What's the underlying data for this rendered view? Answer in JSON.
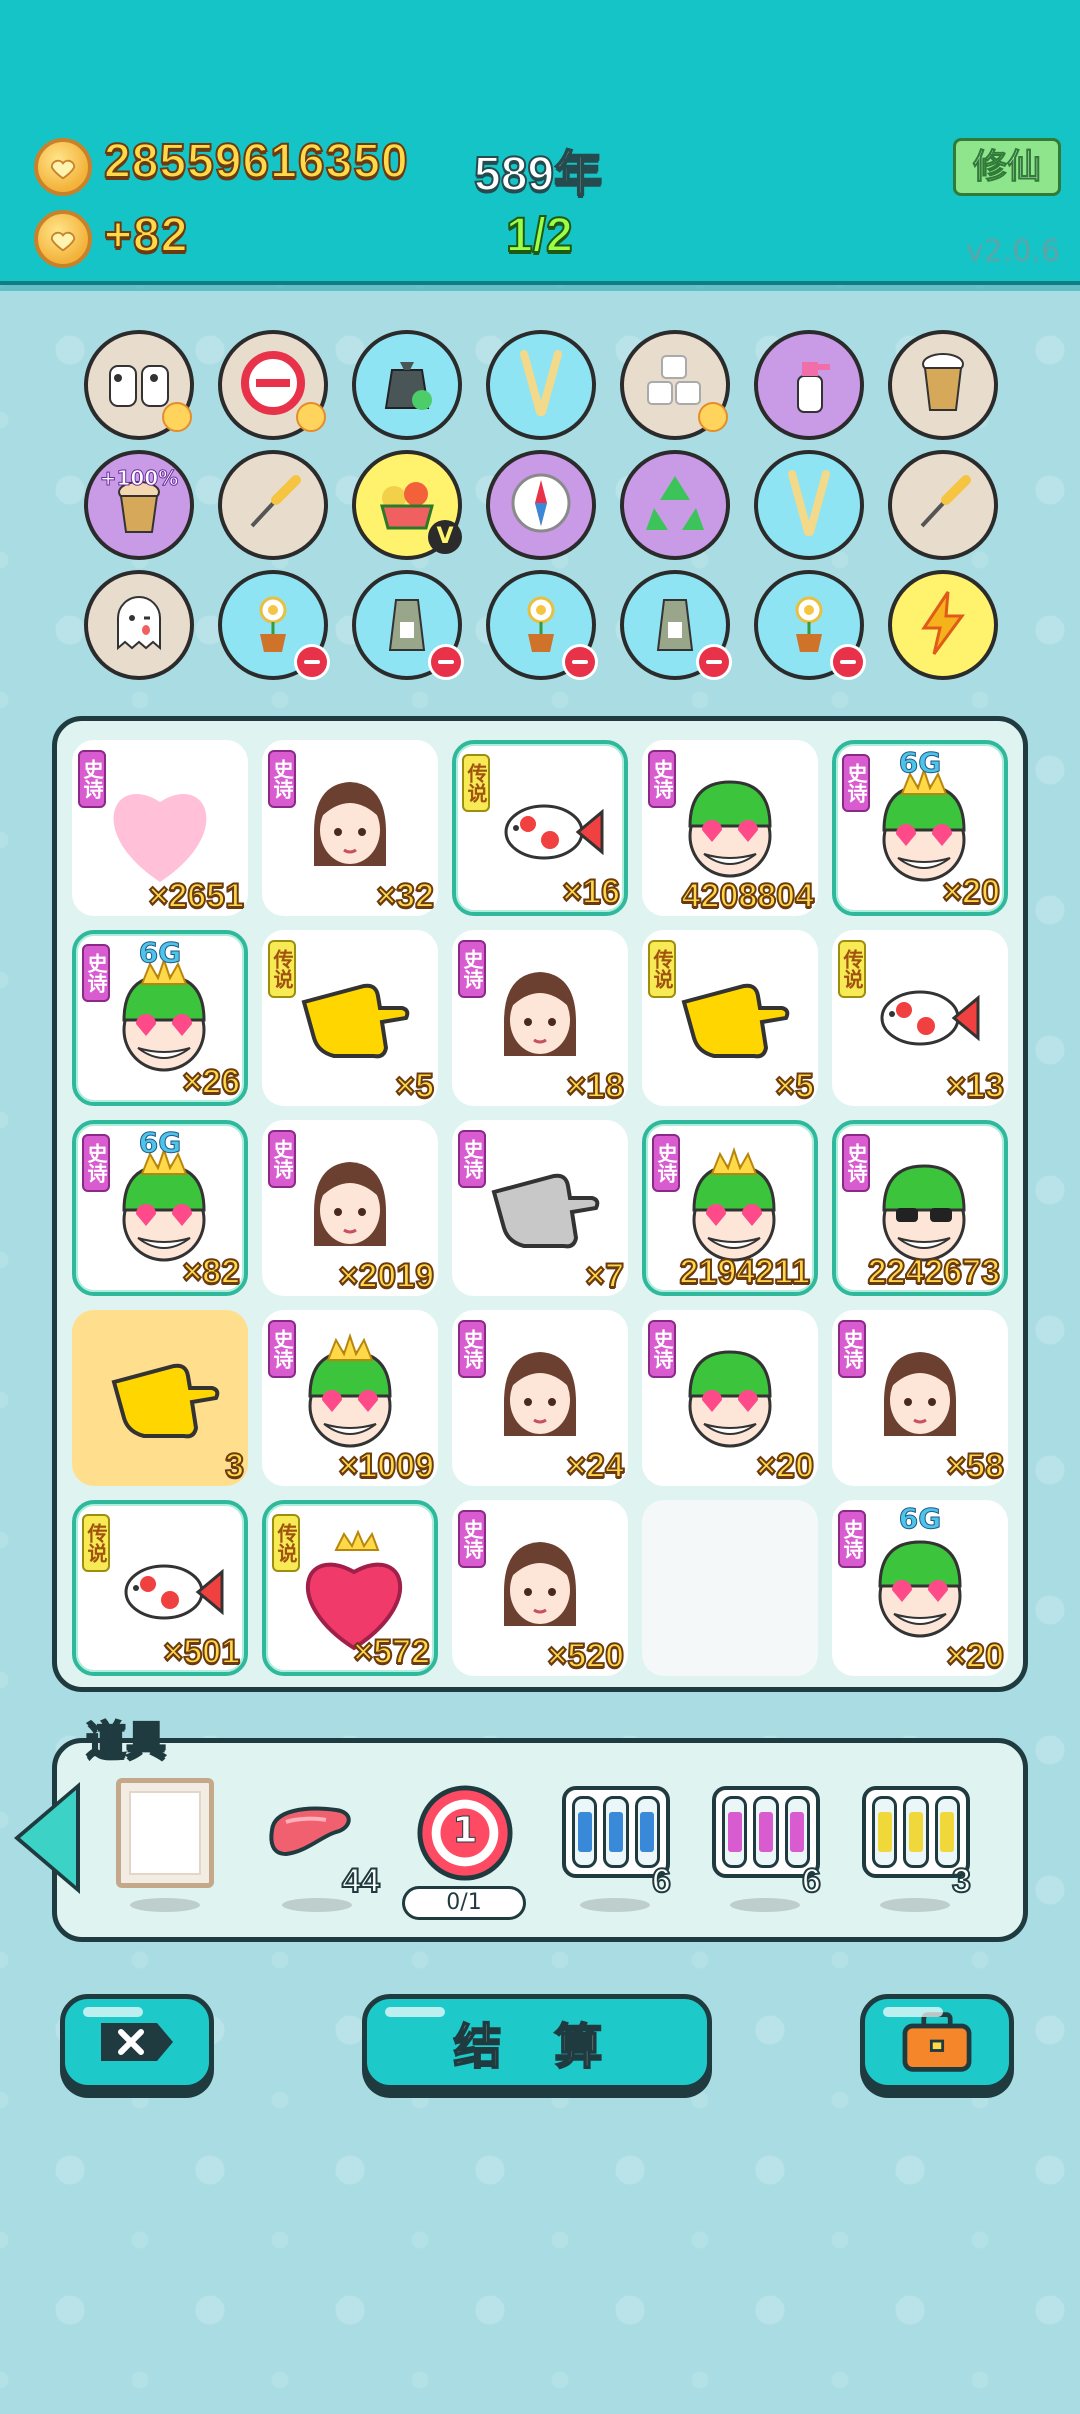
{
  "header": {
    "coins": "28559616350",
    "coin_rate": "+82",
    "year": "589年",
    "stage": "1/2",
    "xiuxian_label": "修仙",
    "version": "v2.0.6"
  },
  "items": [
    {
      "name": "cow-pair-icon",
      "bg": "beige"
    },
    {
      "name": "no-entry-icon",
      "bg": "beige"
    },
    {
      "name": "trash-bag-icon",
      "bg": "blue"
    },
    {
      "name": "chopsticks-icon",
      "bg": "blue"
    },
    {
      "name": "sugar-cubes-icon",
      "bg": "beige"
    },
    {
      "name": "spray-bottle-icon",
      "bg": "purple"
    },
    {
      "name": "milk-tea-icon",
      "bg": "beige"
    },
    {
      "name": "milk-tea-cup-icon",
      "bg": "purple",
      "label": "+100%"
    },
    {
      "name": "screwdriver-icon",
      "bg": "beige"
    },
    {
      "name": "fruit-basket-icon",
      "bg": "yellow"
    },
    {
      "name": "compass-icon",
      "bg": "purple"
    },
    {
      "name": "recycle-icon",
      "bg": "purple"
    },
    {
      "name": "chopsticks-icon",
      "bg": "blue"
    },
    {
      "name": "screwdriver-icon",
      "bg": "beige"
    },
    {
      "name": "ghost-icon",
      "bg": "beige"
    },
    {
      "name": "flower-pot-icon",
      "bg": "blue"
    },
    {
      "name": "seed-bag-icon",
      "bg": "blue"
    },
    {
      "name": "flower-pot-icon",
      "bg": "blue"
    },
    {
      "name": "seed-bag-icon",
      "bg": "blue"
    },
    {
      "name": "flower-pot-icon",
      "bg": "blue"
    },
    {
      "name": "lightning-icon",
      "bg": "yellow"
    }
  ],
  "grid": [
    {
      "tag": "史诗",
      "type": "epic",
      "art": "girl-heart",
      "count": "×2651"
    },
    {
      "tag": "史诗",
      "type": "epic",
      "art": "girl",
      "count": "×32"
    },
    {
      "tag": "传说",
      "type": "legend",
      "art": "koi-fish",
      "count": "×16",
      "framed": true
    },
    {
      "tag": "史诗",
      "type": "epic",
      "art": "man-green",
      "count": "4208804"
    },
    {
      "tag": "史诗",
      "type": "epic",
      "art": "man-crown",
      "count": "×20",
      "framed": true,
      "tier": "6G"
    },
    {
      "tag": "史诗",
      "type": "epic",
      "art": "man-crown",
      "count": "×26",
      "framed": true,
      "tier": "6G"
    },
    {
      "tag": "传说",
      "type": "legend",
      "art": "pointing-hand",
      "count": "×5"
    },
    {
      "tag": "史诗",
      "type": "epic",
      "art": "girl",
      "count": "×18"
    },
    {
      "tag": "传说",
      "type": "legend",
      "art": "pointing-hand",
      "count": "×5"
    },
    {
      "tag": "传说",
      "type": "legend",
      "art": "koi-fish",
      "count": "×13"
    },
    {
      "tag": "史诗",
      "type": "epic",
      "art": "man-crown",
      "count": "×82",
      "framed": true,
      "tier": "6G"
    },
    {
      "tag": "史诗",
      "type": "epic",
      "art": "girl",
      "count": "×2019"
    },
    {
      "tag": "史诗",
      "type": "epic",
      "art": "pointing-hand-gray",
      "count": "×7"
    },
    {
      "tag": "史诗",
      "type": "epic",
      "art": "man-crown",
      "count": "2194211",
      "framed": true
    },
    {
      "tag": "史诗",
      "type": "epic",
      "art": "man-sunglasses",
      "count": "2242673",
      "framed": true
    },
    {
      "tag": "",
      "type": "none",
      "art": "pointing-hand",
      "count": "3",
      "gold": true
    },
    {
      "tag": "史诗",
      "type": "epic",
      "art": "man-crown",
      "count": "×1009"
    },
    {
      "tag": "史诗",
      "type": "epic",
      "art": "girl",
      "count": "×24"
    },
    {
      "tag": "史诗",
      "type": "epic",
      "art": "man-green",
      "count": "×20"
    },
    {
      "tag": "史诗",
      "type": "epic",
      "art": "girl",
      "count": "×58"
    },
    {
      "tag": "传说",
      "type": "legend",
      "art": "koi-fish",
      "count": "×501",
      "framed": true
    },
    {
      "tag": "传说",
      "type": "legend",
      "art": "crown-heart",
      "count": "×572",
      "framed": true
    },
    {
      "tag": "史诗",
      "type": "epic",
      "art": "girl",
      "count": "×520"
    },
    {
      "tag": "",
      "type": "none",
      "art": "",
      "count": "",
      "empty": true
    },
    {
      "tag": "史诗",
      "type": "epic",
      "art": "man-green",
      "count": "×20",
      "tier": "6G"
    }
  ],
  "props": {
    "title": "道具",
    "liver_count": "44",
    "target_number": "1",
    "target_progress": "0/1",
    "slot_rare_count": "6",
    "slot_epic_count": "6",
    "slot_legend_count": "3"
  },
  "buttons": {
    "settle_label": "结 算"
  },
  "colors": {
    "header_bg": "#15c4c6",
    "page_bg": "#a9dde3",
    "epic_tag": "#d95bd0",
    "legend_tag": "#f7ea55",
    "count_gold": "#ffd948",
    "button_teal": "#1ec9c9"
  }
}
